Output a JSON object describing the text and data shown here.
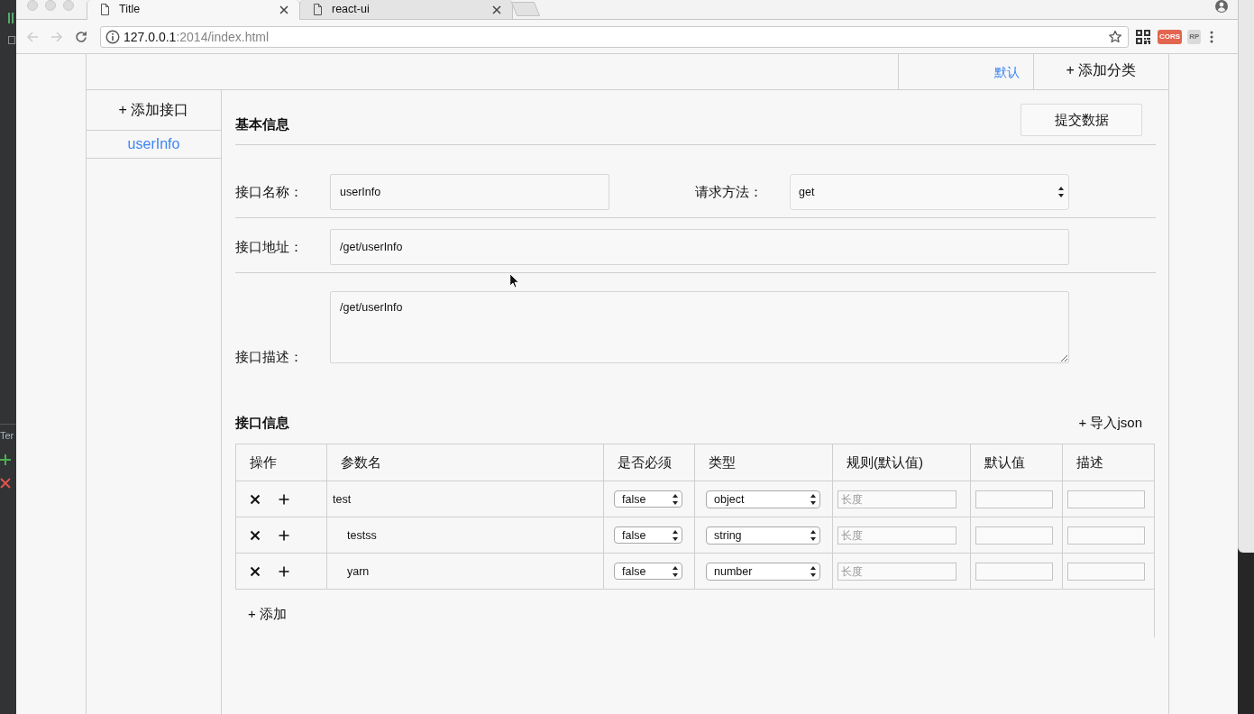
{
  "ide_panel": {
    "label": "Ter"
  },
  "browser": {
    "tabs": [
      {
        "title": "Title",
        "selected": true
      },
      {
        "title": "react-ui",
        "selected": false
      }
    ],
    "navigation": {
      "back_disabled": true,
      "forward_disabled": true
    },
    "address_bar": {
      "host": "127.0.0.1",
      "path": ":2014/index.html"
    },
    "extensions": [
      {
        "kind": "qr"
      },
      {
        "kind": "badge",
        "label": "CORS",
        "color": "#e3654f"
      },
      {
        "kind": "badge",
        "label": "RP",
        "color": "#dadada"
      }
    ]
  },
  "category_bar": {
    "categories": [
      {
        "label": "默认",
        "selected": true
      }
    ],
    "add_button": "+ 添加分类"
  },
  "sidebar": {
    "add_button": "+ 添加接口",
    "items": [
      {
        "label": "userInfo",
        "selected": true
      }
    ]
  },
  "basic_info": {
    "title": "基本信息",
    "submit_button": "提交数据",
    "rows": [
      {
        "fields": [
          {
            "kind": "text",
            "label": "接口名称：",
            "value": "userInfo"
          },
          {
            "kind": "select",
            "label": "请求方法：",
            "value": "get"
          }
        ]
      },
      {
        "fields": [
          {
            "kind": "text",
            "label": "接口地址：",
            "value": "/get/userInfo"
          }
        ]
      },
      {
        "fields": [
          {
            "kind": "textarea",
            "label": "接口描述：",
            "value": "/get/userInfo"
          }
        ]
      }
    ]
  },
  "interface_info": {
    "title": "接口信息",
    "import_button": "+ 导入json",
    "table": {
      "columns": [
        "操作",
        "参数名",
        "是否必须",
        "类型",
        "规则(默认值)",
        "默认值",
        "描述"
      ],
      "rows": [
        {
          "name": "test",
          "required": "false",
          "type": "object",
          "rule_placeholder": "长度",
          "children": [
            {
              "name": "testss",
              "required": "false",
              "type": "string",
              "rule_placeholder": "长度"
            },
            {
              "name": "yarn",
              "required": "false",
              "type": "number",
              "rule_placeholder": "长度"
            }
          ]
        }
      ]
    },
    "add_button": "+ 添加"
  }
}
